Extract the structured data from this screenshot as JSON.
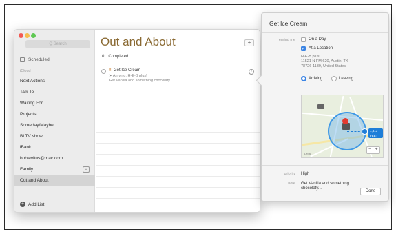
{
  "sidebar": {
    "search_placeholder": "Q Search",
    "scheduled_label": "Scheduled",
    "section_label": "iCloud",
    "lists": [
      {
        "label": "Next Actions"
      },
      {
        "label": "Talk To"
      },
      {
        "label": "Waiting For..."
      },
      {
        "label": "Projects"
      },
      {
        "label": "Someday/Maybe"
      },
      {
        "label": "BLTV show"
      },
      {
        "label": "iBank"
      },
      {
        "label": "boblevitus@mac.com"
      },
      {
        "label": "Family"
      },
      {
        "label": "Out and About"
      }
    ],
    "selected_list": "Out and About",
    "add_list_label": "Add List"
  },
  "main": {
    "title": "Out and About",
    "add_button": "+",
    "completed_count": "0",
    "completed_label": "Completed",
    "reminder": {
      "priority_mark": "!!!",
      "title": "Get Ice Cream",
      "subtitle": "Arriving: H-E-B plus!",
      "note_preview": "Get Vanilla and something chocolaty...",
      "info_glyph": "i"
    }
  },
  "popover": {
    "title": "Get Ice Cream",
    "remind_me_label": "remind me",
    "on_a_day_label": "On a Day",
    "on_a_day_checked": false,
    "at_location_label": "At a Location",
    "at_location_checked": true,
    "location_name": "H-E-B plus!",
    "address_line1": "11521 N FM 620, Austin, TX",
    "address_line2": "78726-1139, United States",
    "arriving_label": "Arriving",
    "leaving_label": "Leaving",
    "selected_trigger": "Arriving",
    "map": {
      "radius_label": "1,313 FEET",
      "legal_label": "Legal",
      "zoom_out": "−",
      "zoom_in": "+"
    },
    "priority_label": "priority",
    "priority_value": "High",
    "note_label": "note",
    "note_value_line1": "Get Vanilla and something",
    "note_value_line2": "chocolaty...",
    "done_label": "Done"
  },
  "colors": {
    "title_brown": "#8a6a33",
    "accent_blue": "#3a84e4",
    "priority_orange": "#c87a2a"
  }
}
